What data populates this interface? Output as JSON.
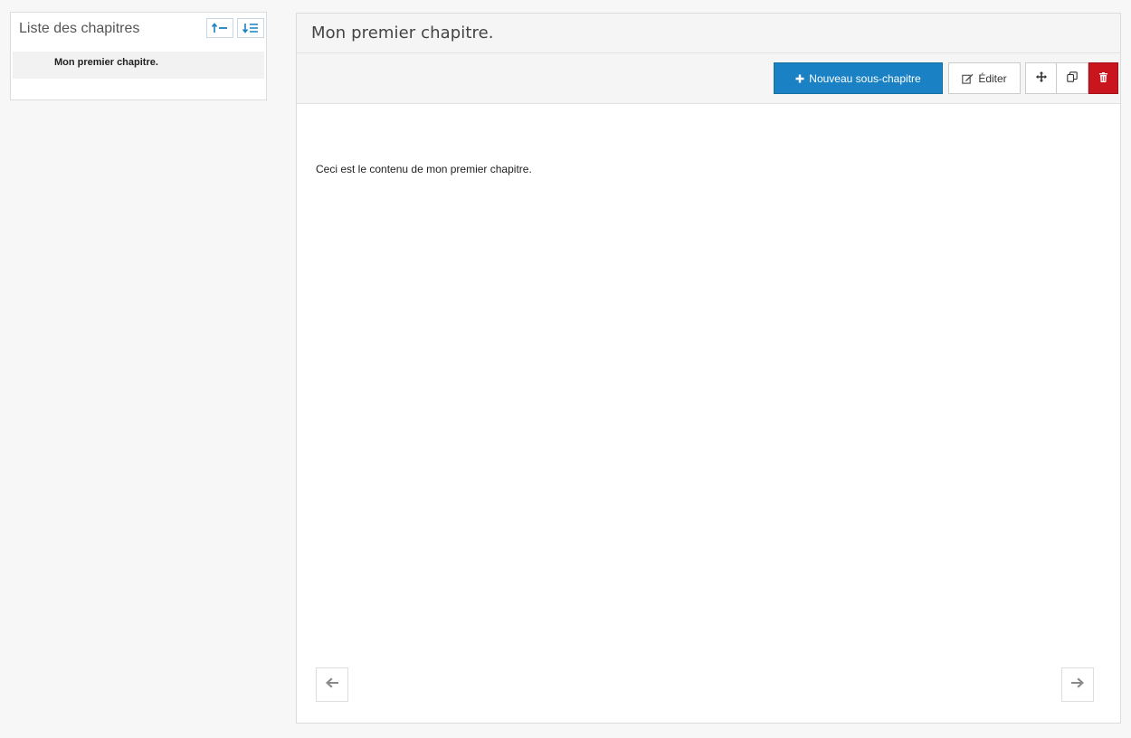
{
  "sidebar": {
    "title": "Liste des chapitres",
    "tools": [
      {
        "icon": "collapse-all-icon"
      },
      {
        "icon": "expand-all-icon"
      }
    ],
    "items": [
      {
        "label": "Mon premier chapitre."
      }
    ]
  },
  "main": {
    "title": "Mon premier chapitre.",
    "toolbar": {
      "new_subchapter_label": "Nouveau sous-chapitre",
      "edit_label": "Éditer",
      "move_icon": "move-icon",
      "copy_icon": "copy-icon",
      "delete_icon": "trash-icon"
    },
    "content": "Ceci est le contenu de mon premier chapitre.",
    "nav": {
      "prev_icon": "arrow-left-icon",
      "next_icon": "arrow-right-icon"
    }
  },
  "colors": {
    "primary": "#1a82c4",
    "danger": "#c9151e",
    "tool_icon": "#1a82c4"
  }
}
